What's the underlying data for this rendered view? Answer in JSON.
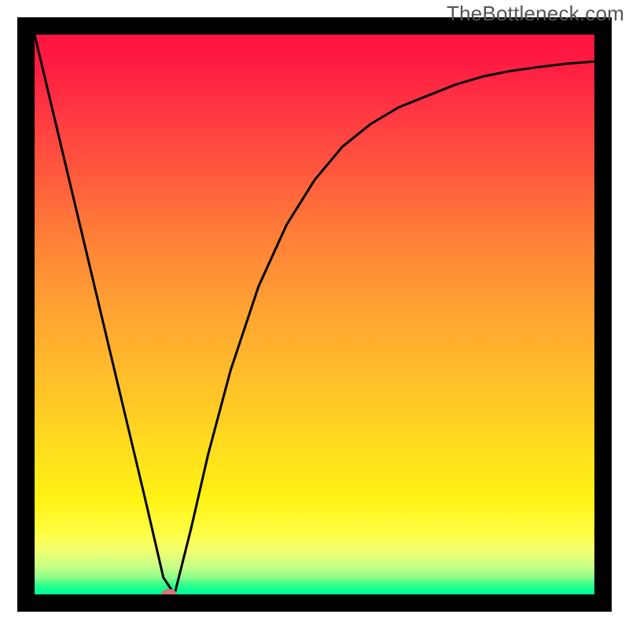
{
  "watermark": "TheBottleneck.com",
  "chart_data": {
    "type": "line",
    "title": "",
    "xlabel": "",
    "ylabel": "",
    "xlim": [
      0,
      100
    ],
    "ylim": [
      0,
      100
    ],
    "grid": false,
    "legend": false,
    "background": "gradient-red-yellow-green",
    "series": [
      {
        "name": "bottleneck-curve",
        "x": [
          0,
          5,
          10,
          15,
          20,
          23,
          25,
          28,
          31,
          35,
          40,
          45,
          50,
          55,
          60,
          65,
          70,
          75,
          80,
          85,
          90,
          95,
          100
        ],
        "values": [
          100,
          79,
          58,
          37,
          16,
          3,
          0,
          12,
          25,
          40,
          55,
          66,
          74,
          80,
          84,
          87,
          89,
          91,
          92.5,
          93.5,
          94.2,
          94.8,
          95.2
        ]
      }
    ],
    "marker": {
      "x": 24,
      "y": 0,
      "color": "#d07878"
    },
    "colors": {
      "top": "#ff1440",
      "mid": "#ffe01d",
      "bottom": "#00ff9b",
      "curve": "#000000",
      "frame": "#000000"
    }
  }
}
